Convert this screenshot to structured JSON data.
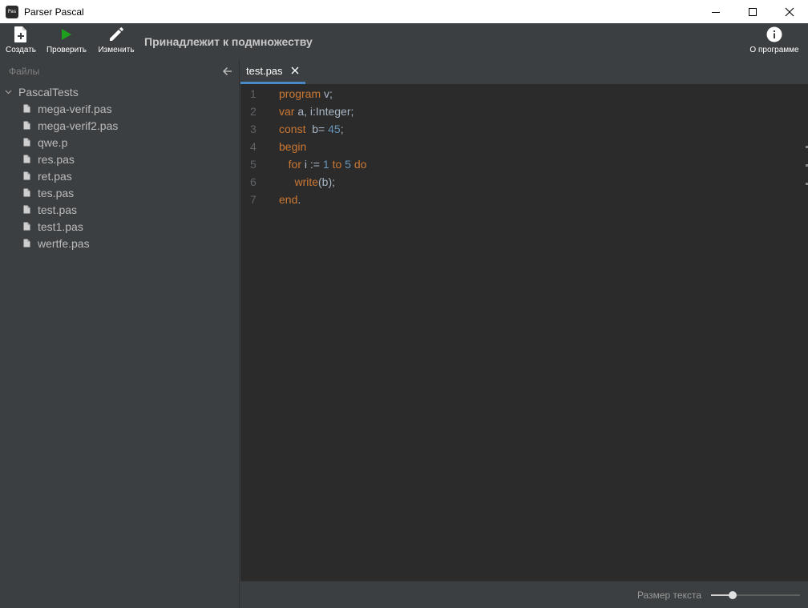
{
  "window": {
    "title": "Parser Pascal",
    "icon_text": "Pas"
  },
  "toolbar": {
    "create_label": "Создать",
    "check_label": "Проверить",
    "edit_label": "Изменить",
    "status_text": "Принадлежит к подмножеству",
    "about_label": "О программе"
  },
  "sidebar": {
    "title": "Файлы",
    "root": "PascalTests",
    "files": [
      "mega-verif.pas",
      "mega-verif2.pas",
      "qwe.p",
      "res.pas",
      "ret.pas",
      "tes.pas",
      "test.pas",
      "test1.pas",
      "wertfe.pas"
    ]
  },
  "editor": {
    "tab_label": "test.pas",
    "lines": [
      {
        "n": "1",
        "parts": [
          {
            "t": "program",
            "c": "kw"
          },
          {
            "t": " v;",
            "c": "plain"
          }
        ]
      },
      {
        "n": "2",
        "parts": [
          {
            "t": "var",
            "c": "kw"
          },
          {
            "t": " a, i:Integer;",
            "c": "plain"
          }
        ]
      },
      {
        "n": "3",
        "parts": [
          {
            "t": "const",
            "c": "kw"
          },
          {
            "t": "  b= ",
            "c": "plain"
          },
          {
            "t": "45",
            "c": "num"
          },
          {
            "t": ";",
            "c": "plain"
          }
        ]
      },
      {
        "n": "4",
        "parts": [
          {
            "t": "begin",
            "c": "kw"
          }
        ]
      },
      {
        "n": "5",
        "parts": [
          {
            "t": "   ",
            "c": "plain"
          },
          {
            "t": "for",
            "c": "kw"
          },
          {
            "t": " i := ",
            "c": "plain"
          },
          {
            "t": "1",
            "c": "num"
          },
          {
            "t": " ",
            "c": "plain"
          },
          {
            "t": "to",
            "c": "kw"
          },
          {
            "t": " ",
            "c": "plain"
          },
          {
            "t": "5",
            "c": "num"
          },
          {
            "t": " ",
            "c": "plain"
          },
          {
            "t": "do",
            "c": "kw"
          }
        ]
      },
      {
        "n": "6",
        "parts": [
          {
            "t": "     ",
            "c": "plain"
          },
          {
            "t": "write",
            "c": "kw"
          },
          {
            "t": "(b);",
            "c": "plain"
          }
        ]
      },
      {
        "n": "7",
        "parts": [
          {
            "t": "end",
            "c": "kw"
          },
          {
            "t": ".",
            "c": "plain"
          }
        ]
      }
    ]
  },
  "statusbar": {
    "text_size_label": "Размер текста",
    "text_size_value": 0.24
  },
  "icons": {
    "app": "parser-pascal-app-icon",
    "create": "new-file-icon",
    "check": "play-icon",
    "edit": "pencil-icon",
    "about": "info-icon",
    "collapse": "arrow-left-icon",
    "file": "file-icon",
    "chevron": "chevron-down-icon",
    "close": "close-icon"
  },
  "colors": {
    "check_green": "#1ea01e",
    "keyword": "#cc7832",
    "number": "#6897bb",
    "text": "#a9b7c6",
    "tab_underline": "#4a88c7"
  }
}
